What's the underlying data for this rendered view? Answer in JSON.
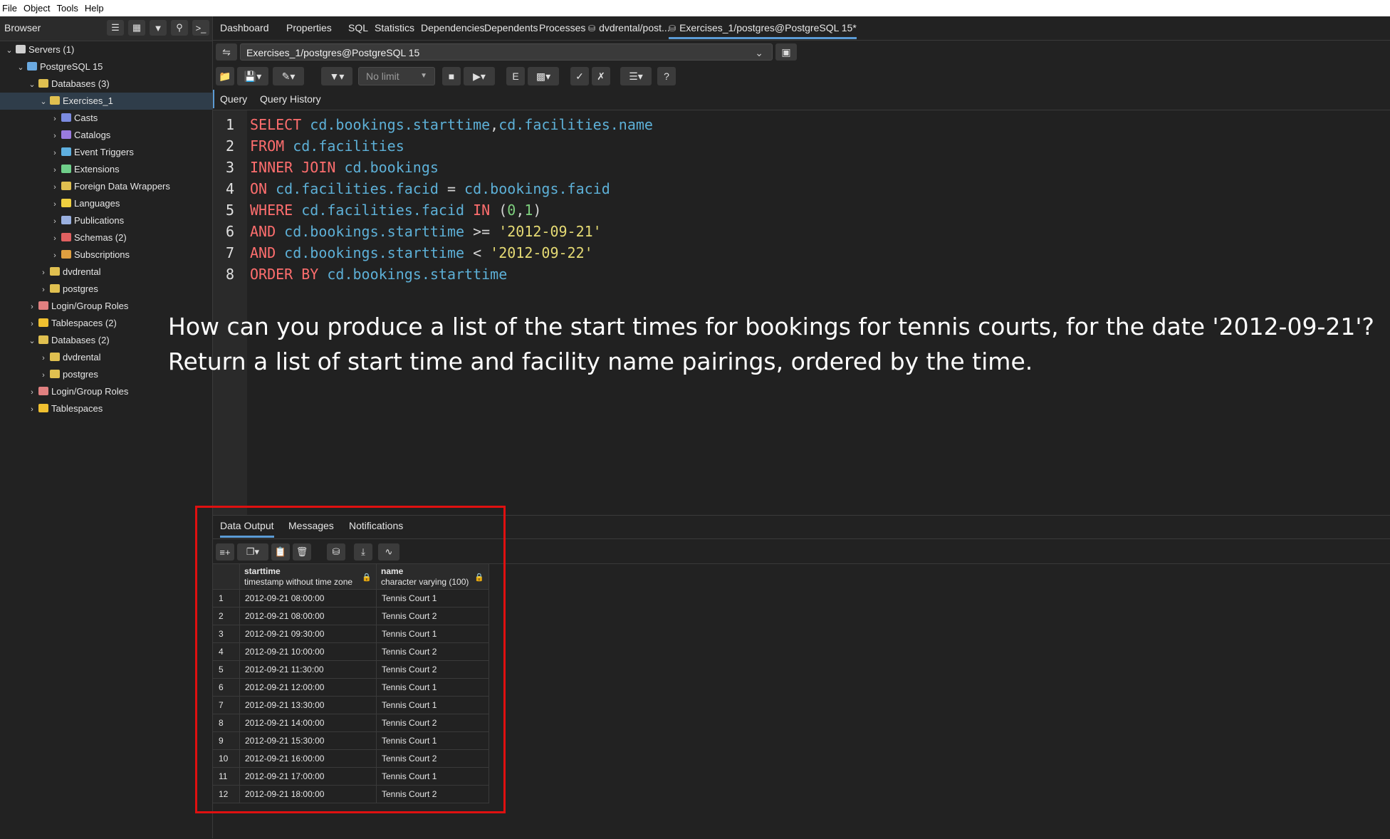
{
  "menu": [
    "File",
    "Object",
    "Tools",
    "Help"
  ],
  "browser": {
    "title": "Browser",
    "tree": [
      {
        "label": "Servers (1)",
        "level": 0,
        "icon": "servers-icon",
        "color": "#cfcfcf"
      },
      {
        "label": "PostgreSQL 15",
        "level": 1,
        "icon": "elephant-icon",
        "color": "#6aa9e0"
      },
      {
        "label": "Databases (3)",
        "level": 2,
        "icon": "database-icon",
        "color": "#e0c050"
      },
      {
        "label": "Exercises_1",
        "level": 3,
        "icon": "database-icon",
        "color": "#e0c050",
        "selected": true
      },
      {
        "label": "Casts",
        "level": 4,
        "icon": "casts-icon",
        "color": "#7b8be0"
      },
      {
        "label": "Catalogs",
        "level": 4,
        "icon": "catalogs-icon",
        "color": "#9a7be0"
      },
      {
        "label": "Event Triggers",
        "level": 4,
        "icon": "event-trigger-icon",
        "color": "#5fb0e0"
      },
      {
        "label": "Extensions",
        "level": 4,
        "icon": "extension-icon",
        "color": "#6fcf8a"
      },
      {
        "label": "Foreign Data Wrappers",
        "level": 4,
        "icon": "fdw-icon",
        "color": "#e0c050"
      },
      {
        "label": "Languages",
        "level": 4,
        "icon": "language-icon",
        "color": "#f0d040"
      },
      {
        "label": "Publications",
        "level": 4,
        "icon": "publication-icon",
        "color": "#9ab0e0"
      },
      {
        "label": "Schemas (2)",
        "level": 4,
        "icon": "schema-icon",
        "color": "#e06060"
      },
      {
        "label": "Subscriptions",
        "level": 4,
        "icon": "subscription-icon",
        "color": "#e0a040"
      },
      {
        "label": "dvdrental",
        "level": 3,
        "icon": "database-icon",
        "color": "#e0c050"
      },
      {
        "label": "postgres",
        "level": 3,
        "icon": "database-icon",
        "color": "#e0c050"
      },
      {
        "label": "Login/Group Roles",
        "level": 2,
        "icon": "roles-icon",
        "color": "#e08080"
      },
      {
        "label": "Tablespaces (2)",
        "level": 2,
        "icon": "tablespace-icon",
        "color": "#f0c030"
      },
      {
        "label": "Databases (2)",
        "level": 2,
        "icon": "database-icon",
        "color": "#e0c050"
      },
      {
        "label": "dvdrental",
        "level": 3,
        "icon": "database-icon",
        "color": "#e0c050"
      },
      {
        "label": "postgres",
        "level": 3,
        "icon": "database-icon",
        "color": "#e0c050"
      },
      {
        "label": "Login/Group Roles",
        "level": 2,
        "icon": "roles-icon",
        "color": "#e08080"
      },
      {
        "label": "Tablespaces",
        "level": 2,
        "icon": "tablespace-icon",
        "color": "#f0c030"
      }
    ]
  },
  "main_tabs": [
    {
      "label": "Dashboard"
    },
    {
      "label": "Properties"
    },
    {
      "label": "SQL"
    },
    {
      "label": "Statistics"
    },
    {
      "label": "Dependencies"
    },
    {
      "label": "Dependents"
    },
    {
      "label": "Processes"
    },
    {
      "label": "dvdrental/post..."
    },
    {
      "label": "Exercises_1/postgres@PostgreSQL 15*",
      "active": true
    }
  ],
  "connection": {
    "value": "Exercises_1/postgres@PostgreSQL 15"
  },
  "toolbar": {
    "limit": "No limit"
  },
  "query_tabs": [
    {
      "label": "Query",
      "active": true
    },
    {
      "label": "Query History"
    }
  ],
  "line_numbers": [
    "1",
    "2",
    "3",
    "4",
    "5",
    "6",
    "7",
    "8"
  ],
  "sql_lines": [
    [
      {
        "t": "SELECT",
        "c": "kw"
      },
      {
        "t": " cd.bookings.starttime",
        "c": "id"
      },
      {
        "t": ",",
        "c": "op"
      },
      {
        "t": "cd.facilities.name",
        "c": "id"
      }
    ],
    [
      {
        "t": "FROM",
        "c": "kw"
      },
      {
        "t": " cd.facilities",
        "c": "id"
      }
    ],
    [
      {
        "t": "INNER JOIN",
        "c": "kw"
      },
      {
        "t": " cd.bookings",
        "c": "id"
      }
    ],
    [
      {
        "t": "ON",
        "c": "kw"
      },
      {
        "t": " cd.facilities.facid ",
        "c": "id"
      },
      {
        "t": "=",
        "c": "op"
      },
      {
        "t": " cd.bookings.facid",
        "c": "id"
      }
    ],
    [
      {
        "t": "WHERE",
        "c": "kw"
      },
      {
        "t": " cd.facilities.facid ",
        "c": "id"
      },
      {
        "t": "IN",
        "c": "kw"
      },
      {
        "t": " (",
        "c": "op"
      },
      {
        "t": "0",
        "c": "num"
      },
      {
        "t": ",",
        "c": "op"
      },
      {
        "t": "1",
        "c": "num"
      },
      {
        "t": ")",
        "c": "op"
      }
    ],
    [
      {
        "t": "AND",
        "c": "kw"
      },
      {
        "t": " cd.bookings.starttime ",
        "c": "id"
      },
      {
        "t": ">=",
        "c": "op"
      },
      {
        "t": " '2012-09-21'",
        "c": "str"
      }
    ],
    [
      {
        "t": "AND",
        "c": "kw"
      },
      {
        "t": " cd.bookings.starttime ",
        "c": "id"
      },
      {
        "t": "<",
        "c": "op"
      },
      {
        "t": " '2012-09-22'",
        "c": "str"
      }
    ],
    [
      {
        "t": "ORDER BY",
        "c": "kw"
      },
      {
        "t": " cd.bookings.starttime",
        "c": "id"
      }
    ]
  ],
  "caption": {
    "line1": "How can you produce a list of the start times for bookings for tennis courts, for the date '2012-09-21'?",
    "line2": "Return a list of start time and facility name pairings, ordered by the time."
  },
  "result_tabs": [
    {
      "label": "Data Output",
      "active": true
    },
    {
      "label": "Messages"
    },
    {
      "label": "Notifications"
    }
  ],
  "columns": [
    {
      "name": "starttime",
      "type": "timestamp without time zone"
    },
    {
      "name": "name",
      "type": "character varying (100)"
    }
  ],
  "rows": [
    [
      "1",
      "2012-09-21 08:00:00",
      "Tennis Court 1"
    ],
    [
      "2",
      "2012-09-21 08:00:00",
      "Tennis Court 2"
    ],
    [
      "3",
      "2012-09-21 09:30:00",
      "Tennis Court 1"
    ],
    [
      "4",
      "2012-09-21 10:00:00",
      "Tennis Court 2"
    ],
    [
      "5",
      "2012-09-21 11:30:00",
      "Tennis Court 2"
    ],
    [
      "6",
      "2012-09-21 12:00:00",
      "Tennis Court 1"
    ],
    [
      "7",
      "2012-09-21 13:30:00",
      "Tennis Court 1"
    ],
    [
      "8",
      "2012-09-21 14:00:00",
      "Tennis Court 2"
    ],
    [
      "9",
      "2012-09-21 15:30:00",
      "Tennis Court 1"
    ],
    [
      "10",
      "2012-09-21 16:00:00",
      "Tennis Court 2"
    ],
    [
      "11",
      "2012-09-21 17:00:00",
      "Tennis Court 1"
    ],
    [
      "12",
      "2012-09-21 18:00:00",
      "Tennis Court 2"
    ]
  ],
  "colors": {
    "accent": "#5b9bd5",
    "highlight": "#e01010",
    "keyword": "#ff6e6e",
    "identifier": "#5db0d7",
    "string": "#e6db74",
    "number": "#7ed07e"
  }
}
